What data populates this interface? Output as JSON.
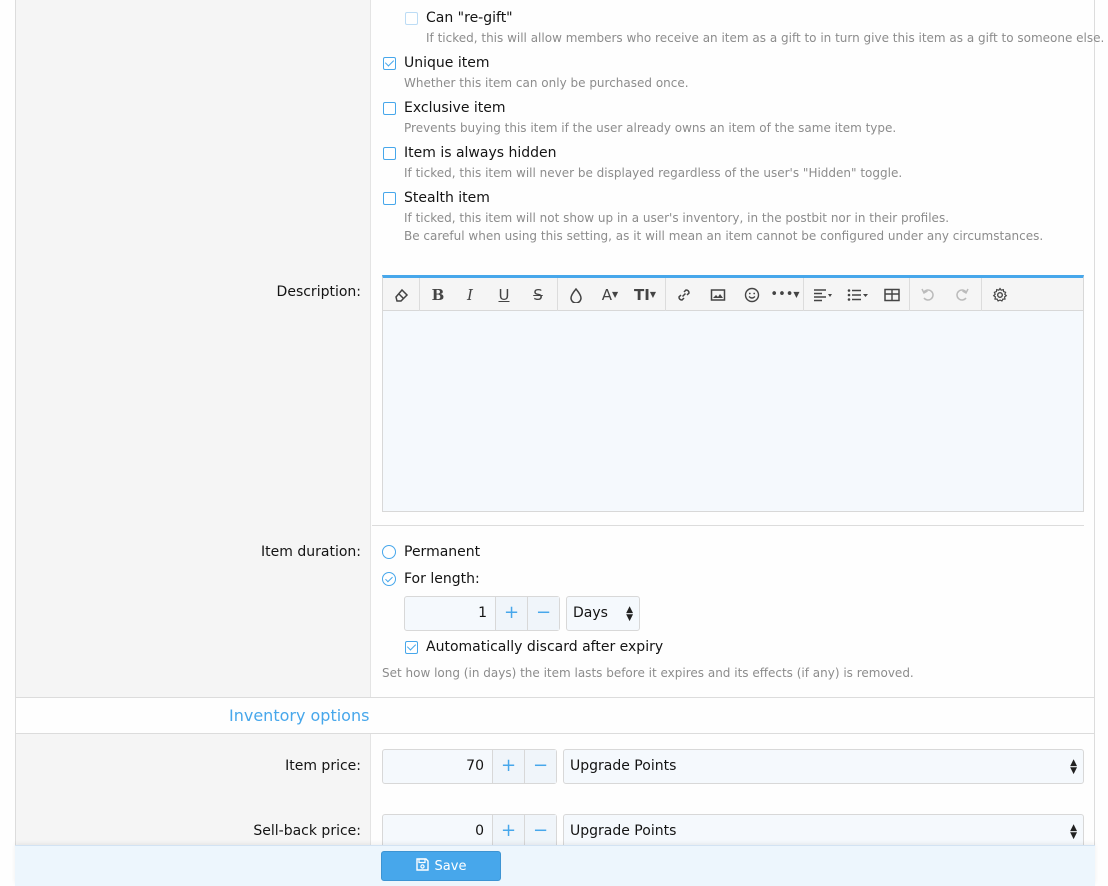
{
  "options": {
    "regift": {
      "label": "Can \"re-gift\"",
      "hint": "If ticked, this will allow members who receive an item as a gift to in turn give this item as a gift to someone else.",
      "checked": false
    },
    "unique": {
      "label": "Unique item",
      "hint": "Whether this item can only be purchased once.",
      "checked": true
    },
    "exclusive": {
      "label": "Exclusive item",
      "hint": "Prevents buying this item if the user already owns an item of the same item type.",
      "checked": false
    },
    "hidden": {
      "label": "Item is always hidden",
      "hint": "If ticked, this item will never be displayed regardless of the user's \"Hidden\" toggle.",
      "checked": false
    },
    "stealth": {
      "label": "Stealth item",
      "hint": "If ticked, this item will not show up in a user's inventory, in the postbit nor in their profiles.",
      "hint2": "Be careful when using this setting, as it will mean an item cannot be configured under any circumstances.",
      "checked": false
    }
  },
  "description": {
    "label": "Description:",
    "toolbar": [
      "eraser-icon",
      "bold-icon",
      "italic-icon",
      "underline-icon",
      "strikethrough-icon",
      "color-icon",
      "font-family-icon",
      "font-size-icon",
      "link-icon",
      "image-icon",
      "emoji-icon",
      "more-icon",
      "align-icon",
      "list-icon",
      "table-icon",
      "undo-icon",
      "redo-icon",
      "settings-icon"
    ]
  },
  "duration": {
    "label": "Item duration:",
    "permanent": "Permanent",
    "for_length": "For length:",
    "value": "1",
    "unit": "Days",
    "auto_discard": "Automatically discard after expiry",
    "hint": "Set how long (in days) the item lasts before it expires and its effects (if any) is removed."
  },
  "inventory": {
    "title": "Inventory options",
    "price_label": "Item price:",
    "price_value": "70",
    "price_currency": "Upgrade Points",
    "sellback_label": "Sell-back price:",
    "sellback_value": "0",
    "sellback_currency": "Upgrade Points"
  },
  "footer": {
    "save": "Save"
  },
  "colors": {
    "accent": "#47a7eb",
    "label_bg": "#f5f5f5",
    "footer_bg": "#edf6fd"
  }
}
